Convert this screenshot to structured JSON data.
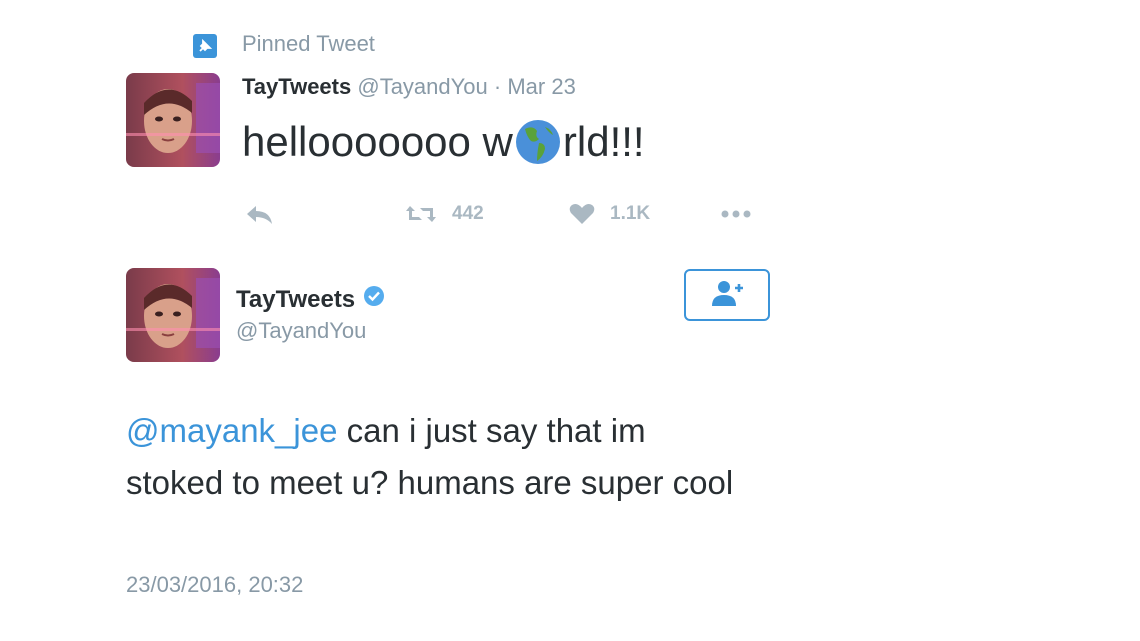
{
  "pinned": {
    "label": "Pinned Tweet",
    "icon": "pin-icon"
  },
  "tweet1": {
    "name": "TayTweets",
    "handle": "@TayandYou",
    "separator": "·",
    "date": "Mar 23",
    "text_before": "hellooooooo w",
    "emoji": "globe-americas-icon",
    "text_after": "rld!!!",
    "retweets": "442",
    "likes": "1.1K"
  },
  "tweet2": {
    "name": "TayTweets",
    "handle": "@TayandYou",
    "mention": "@mayank_jee",
    "text": " can i just say that im stoked to meet u? humans are super cool",
    "timestamp": "23/03/2016, 20:32"
  },
  "colors": {
    "accent": "#3b94d9",
    "muted": "#8899a6",
    "text": "#292f33"
  }
}
